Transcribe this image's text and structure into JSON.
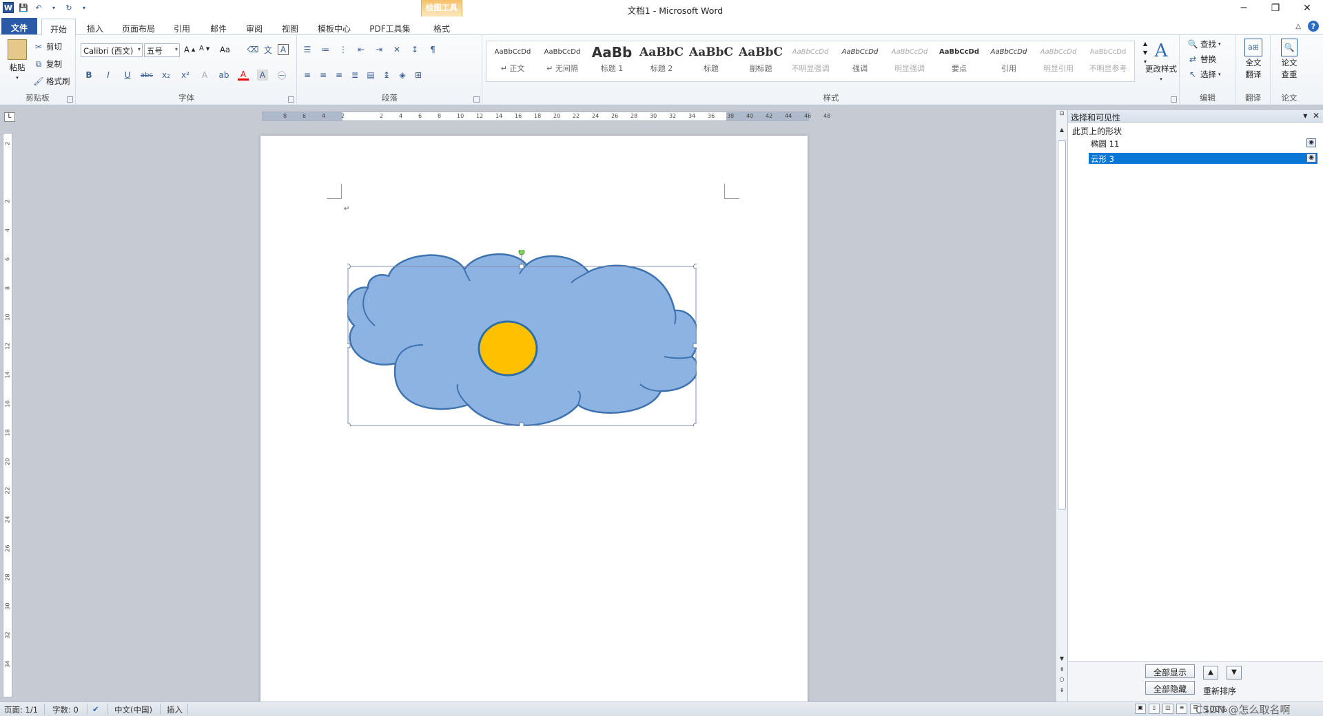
{
  "window": {
    "title": "文档1  -  Microsoft Word",
    "context_group": "绘图工具"
  },
  "tabs": {
    "file": "文件",
    "home": "开始",
    "insert": "插入",
    "page_layout": "页面布局",
    "references": "引用",
    "mailings": "邮件",
    "review": "审阅",
    "view": "视图",
    "template_center": "模板中心",
    "pdf_tools": "PDF工具集",
    "format": "格式"
  },
  "ribbon": {
    "clipboard": {
      "name": "剪贴板",
      "paste": "粘贴",
      "cut": "剪切",
      "copy": "复制",
      "format_painter": "格式刷"
    },
    "font": {
      "name": "字体",
      "font_name": "Calibri (西文)",
      "font_size": "五号",
      "grow": "A",
      "shrink": "A",
      "aa": "Aa"
    },
    "paragraph": {
      "name": "段落"
    },
    "styles": {
      "name": "样式",
      "items": [
        {
          "sample": "AaBbCcDd",
          "label": "↵ 正文"
        },
        {
          "sample": "AaBbCcDd",
          "label": "↵ 无间隔"
        },
        {
          "sample": "AaBb",
          "label": "标题 1"
        },
        {
          "sample": "AaBbC",
          "label": "标题 2"
        },
        {
          "sample": "AaBbC",
          "label": "标题"
        },
        {
          "sample": "AaBbC",
          "label": "副标题"
        },
        {
          "sample": "AaBbCcDd",
          "label": "不明显强调"
        },
        {
          "sample": "AaBbCcDd",
          "label": "强调"
        },
        {
          "sample": "AaBbCcDd",
          "label": "明显强调"
        },
        {
          "sample": "AaBbCcDd",
          "label": "要点"
        },
        {
          "sample": "AaBbCcDd",
          "label": "引用"
        },
        {
          "sample": "AaBbCcDd",
          "label": "明显引用"
        },
        {
          "sample": "AaBbCcDd",
          "label": "不明显参考"
        }
      ],
      "change_styles": "更改样式"
    },
    "editing": {
      "name": "编辑",
      "find": "查找",
      "replace": "替换",
      "select": "选择"
    },
    "translate": {
      "name": "翻译",
      "full_text": "全文",
      "translate_label": "翻译"
    },
    "paper": {
      "name": "论文",
      "paper_label": "论文",
      "check": "查重"
    }
  },
  "ruler": {
    "h_ticks": [
      "8",
      "6",
      "4",
      "2",
      "",
      "2",
      "4",
      "6",
      "8",
      "10",
      "12",
      "14",
      "16",
      "18",
      "20",
      "22",
      "24",
      "26",
      "28",
      "30",
      "32",
      "34",
      "36",
      "38",
      "40",
      "42",
      "44",
      "46",
      "48"
    ],
    "v_ticks": [
      "2",
      "",
      "2",
      "4",
      "6",
      "8",
      "10",
      "12",
      "14",
      "16",
      "18",
      "20",
      "22",
      "24",
      "26",
      "28",
      "30",
      "32",
      "34"
    ]
  },
  "document": {
    "pilcrow": "↵"
  },
  "selection_pane": {
    "title": "选择和可见性",
    "subtitle": "此页上的形状",
    "items": [
      {
        "label": "椭圆 11",
        "selected": false
      },
      {
        "label": "云形 3",
        "selected": true
      }
    ],
    "show_all": "全部显示",
    "hide_all": "全部隐藏",
    "reorder": "重新排序"
  },
  "status": {
    "page": "页面: 1/1",
    "words": "字数: 0",
    "language": "中文(中国)",
    "insert_mode": "插入",
    "zoom": "100%",
    "watermark": "CSDN @怎么取名啊"
  },
  "colors": {
    "cloud_fill": "#8db3e2",
    "cloud_stroke": "#3f73b0",
    "ellipse_fill": "#ffc000",
    "ellipse_stroke": "#2e6fa5",
    "selection_highlight": "#0a76d6",
    "file_tab": "#2b5ba8"
  }
}
